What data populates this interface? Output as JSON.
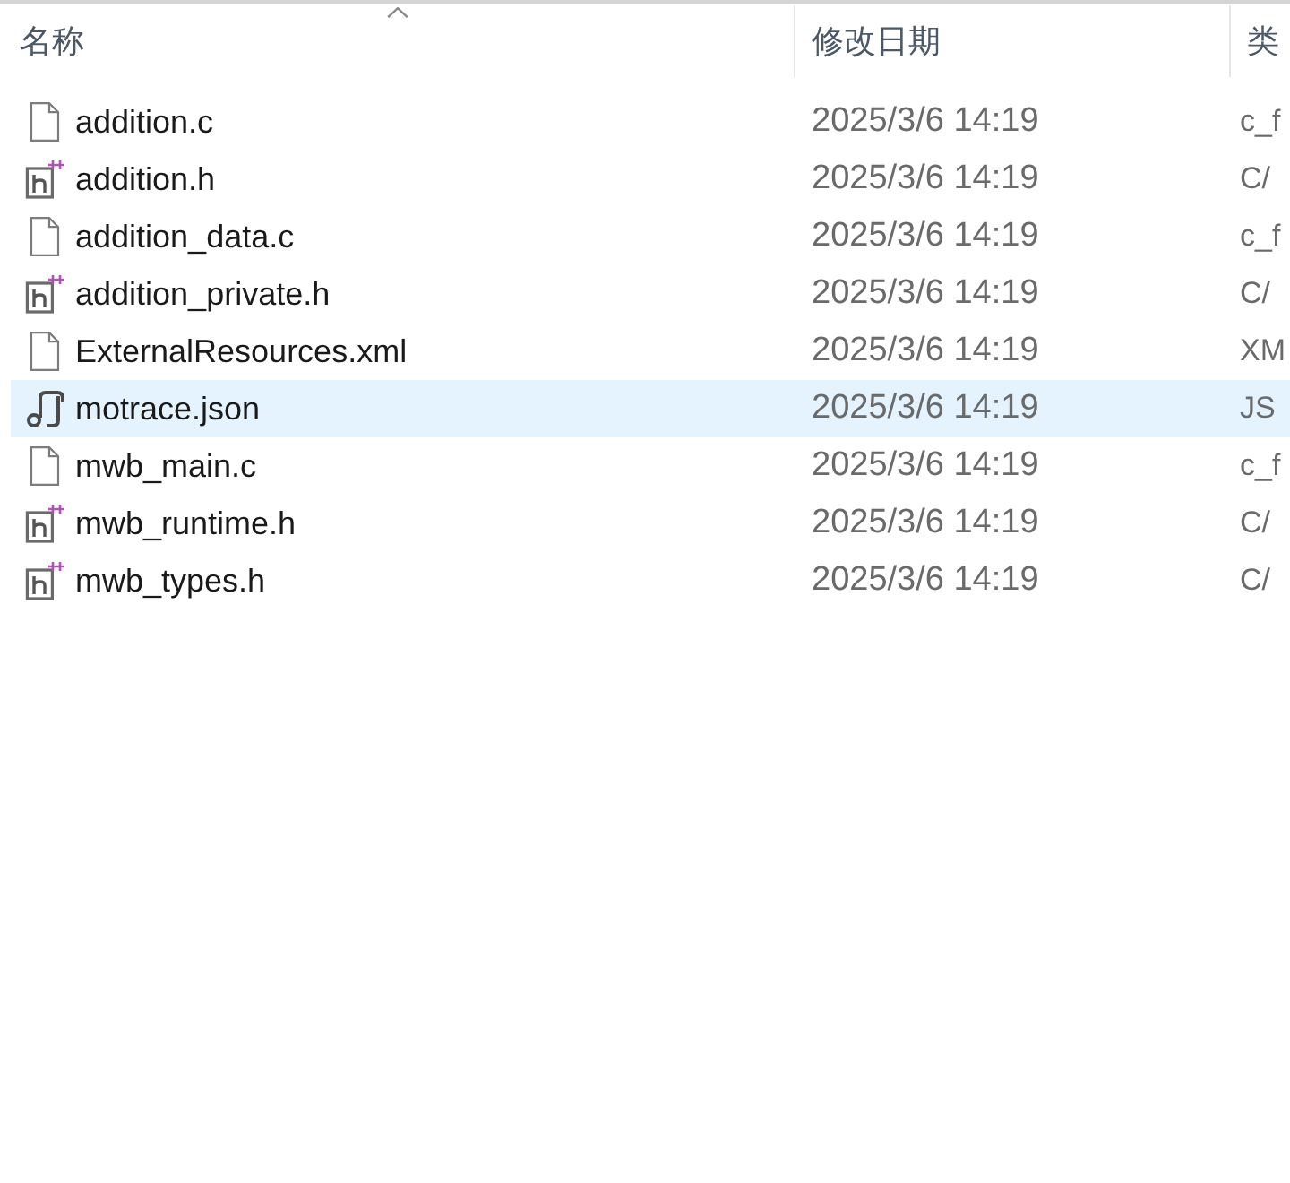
{
  "columns": [
    {
      "label": "名称",
      "sorted": true
    },
    {
      "label": "修改日期",
      "sorted": false
    },
    {
      "label": "类",
      "sorted": false
    }
  ],
  "files": [
    {
      "name": "addition.c",
      "modified": "2025/3/6 14:19",
      "type": "c_f",
      "kind": "doc",
      "selected": false
    },
    {
      "name": "addition.h",
      "modified": "2025/3/6 14:19",
      "type": "C/",
      "kind": "header",
      "selected": false
    },
    {
      "name": "addition_data.c",
      "modified": "2025/3/6 14:19",
      "type": "c_f",
      "kind": "doc",
      "selected": false
    },
    {
      "name": "addition_private.h",
      "modified": "2025/3/6 14:19",
      "type": "C/",
      "kind": "header",
      "selected": false
    },
    {
      "name": "ExternalResources.xml",
      "modified": "2025/3/6 14:19",
      "type": "XM",
      "kind": "doc",
      "selected": false
    },
    {
      "name": "motrace.json",
      "modified": "2025/3/6 14:19",
      "type": "JS",
      "kind": "json",
      "selected": true
    },
    {
      "name": "mwb_main.c",
      "modified": "2025/3/6 14:19",
      "type": "c_f",
      "kind": "doc",
      "selected": false
    },
    {
      "name": "mwb_runtime.h",
      "modified": "2025/3/6 14:19",
      "type": "C/",
      "kind": "header",
      "selected": false
    },
    {
      "name": "mwb_types.h",
      "modified": "2025/3/6 14:19",
      "type": "C/",
      "kind": "header",
      "selected": false
    }
  ]
}
